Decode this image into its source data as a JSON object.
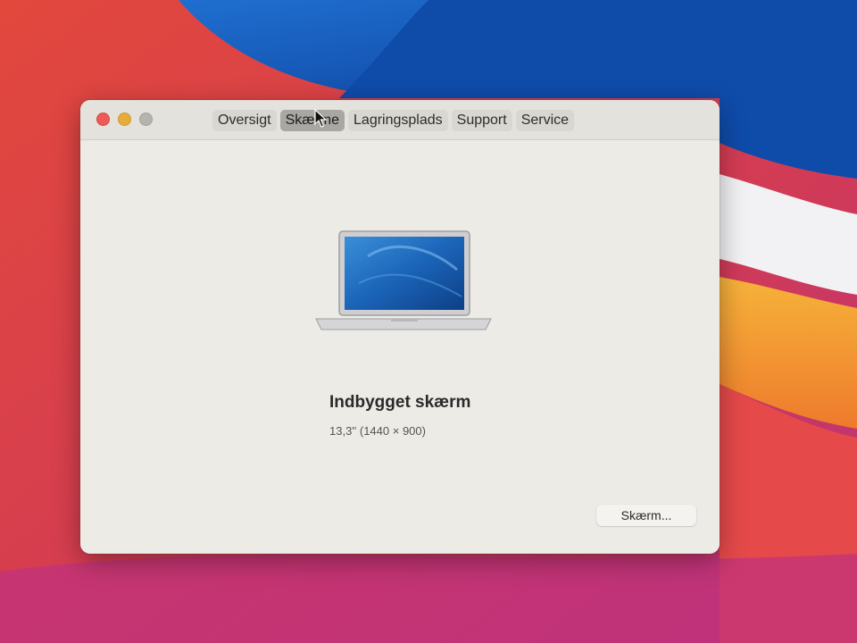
{
  "window": {
    "tabs": [
      {
        "label": "Oversigt",
        "selected": false
      },
      {
        "label": "Skærme",
        "selected": true
      },
      {
        "label": "Lagringsplads",
        "selected": false
      },
      {
        "label": "Support",
        "selected": false
      },
      {
        "label": "Service",
        "selected": false
      }
    ]
  },
  "display": {
    "name": "Indbygget skærm",
    "spec": "13,3'' (1440 × 900)",
    "button_label": "Skærm..."
  },
  "icons": {
    "close": "close-icon",
    "minimize": "minimize-icon",
    "zoom": "zoom-icon",
    "laptop": "laptop-icon",
    "cursor": "cursor-icon"
  },
  "colors": {
    "close": "#ec5b55",
    "minimize": "#e7ad3a",
    "zoom": "#b6b3ad",
    "selected_tab": "#a9a7a2",
    "window_bg": "#ecebe6"
  }
}
